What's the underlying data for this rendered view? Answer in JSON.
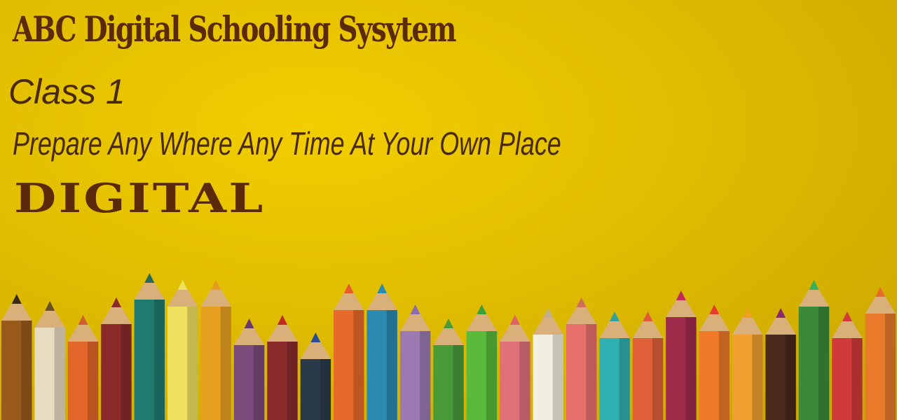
{
  "banner": {
    "title": "ABC Digital Schooling Sysytem",
    "class_label": "Class 1",
    "tagline": "Prepare Any Where Any Time At Your Own Place",
    "highlight": "DIGITAL"
  },
  "colors": {
    "background": "#e2bf00",
    "text_dark_brown": "#5b2a0a",
    "text_brown": "#4a2a0c"
  },
  "pencils": [
    {
      "color": "#9a5a1a",
      "tip": "#3a2a1a"
    },
    {
      "color": "#e8dcc0",
      "tip": "#6a5020"
    },
    {
      "color": "#e2662a",
      "tip": "#d06030"
    },
    {
      "color": "#8a2a2a",
      "tip": "#8a2a2a"
    },
    {
      "color": "#1f7a70",
      "tip": "#2a6a5a"
    },
    {
      "color": "#f0e060",
      "tip": "#f0e060"
    },
    {
      "color": "#e8a020",
      "tip": "#e89a20"
    },
    {
      "color": "#7a4a7a",
      "tip": "#6a3a6a"
    },
    {
      "color": "#8a2a2a",
      "tip": "#c02a20"
    },
    {
      "color": "#2a3a4a",
      "tip": "#2a4a9a"
    },
    {
      "color": "#e86a2a",
      "tip": "#e85a2a"
    },
    {
      "color": "#2a8ab0",
      "tip": "#2a8ab0"
    },
    {
      "color": "#9a7ab0",
      "tip": "#8a6ab0"
    },
    {
      "color": "#4a9a3a",
      "tip": "#4a9a3a"
    },
    {
      "color": "#5aba3a",
      "tip": "#3aa03a"
    },
    {
      "color": "#e0707a",
      "tip": "#e0606a"
    },
    {
      "color": "#f2eee0",
      "tip": "#c0b090"
    },
    {
      "color": "#e8706a",
      "tip": "#d06a5a"
    },
    {
      "color": "#30b0b0",
      "tip": "#30a0a0"
    },
    {
      "color": "#e0603a",
      "tip": "#e05a3a"
    },
    {
      "color": "#a02a4a",
      "tip": "#c02a5a"
    },
    {
      "color": "#f07a2a",
      "tip": "#e83a2a"
    },
    {
      "color": "#f0a030",
      "tip": "#f0a020"
    },
    {
      "color": "#4a2a1a",
      "tip": "#8a2a6a"
    },
    {
      "color": "#3a8a3a",
      "tip": "#3ab05a"
    },
    {
      "color": "#d03a3a",
      "tip": "#d03a3a"
    },
    {
      "color": "#e87a2a",
      "tip": "#e86a2a"
    }
  ]
}
